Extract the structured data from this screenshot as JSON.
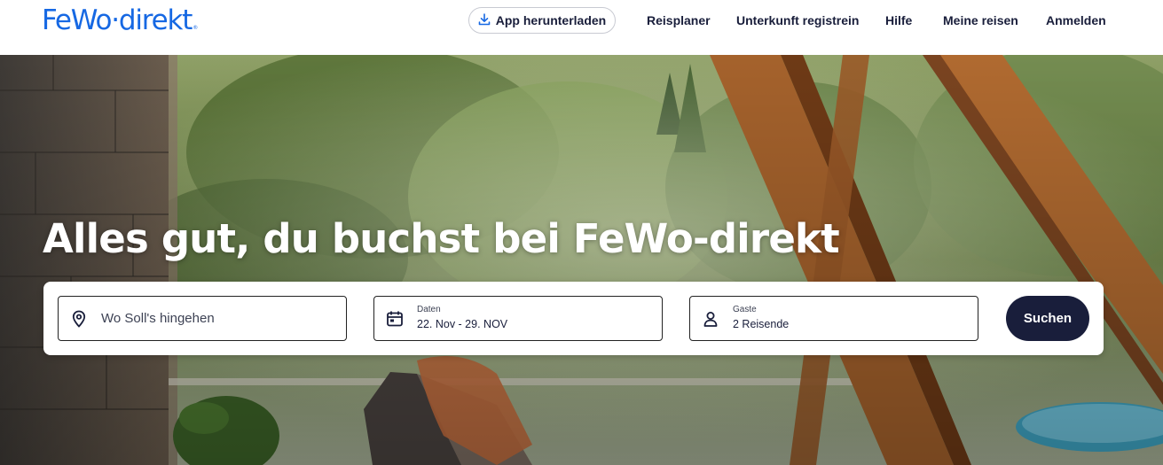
{
  "header": {
    "logo_text": "FeWo·direkt",
    "logo_mark": "®",
    "app_button_label": "App herunterladen",
    "nav": {
      "reiseplaner": "Reisplaner",
      "register": "Unterkunft registrein",
      "help": "Hilfe",
      "trips": "Meine reisen",
      "login": "Anmelden"
    }
  },
  "hero": {
    "headline": "Alles gut, du buchst bei FeWo-direkt",
    "image_description_colors": {
      "foliage": "#6f8a4a",
      "wood": "#a5622c",
      "stone": "#6b5a4a"
    }
  },
  "search": {
    "destination": {
      "placeholder": "Wo Soll's hingehen",
      "icon": "location-pin-icon"
    },
    "dates": {
      "label": "Daten",
      "value": "22. Nov - 29. NOV",
      "icon": "calendar-icon"
    },
    "guests": {
      "label": "Gaste",
      "value": "2 Reisende",
      "icon": "person-icon"
    },
    "submit_label": "Suchen"
  },
  "colors": {
    "brand_blue": "#1668e3",
    "dark_navy": "#191e3b"
  }
}
